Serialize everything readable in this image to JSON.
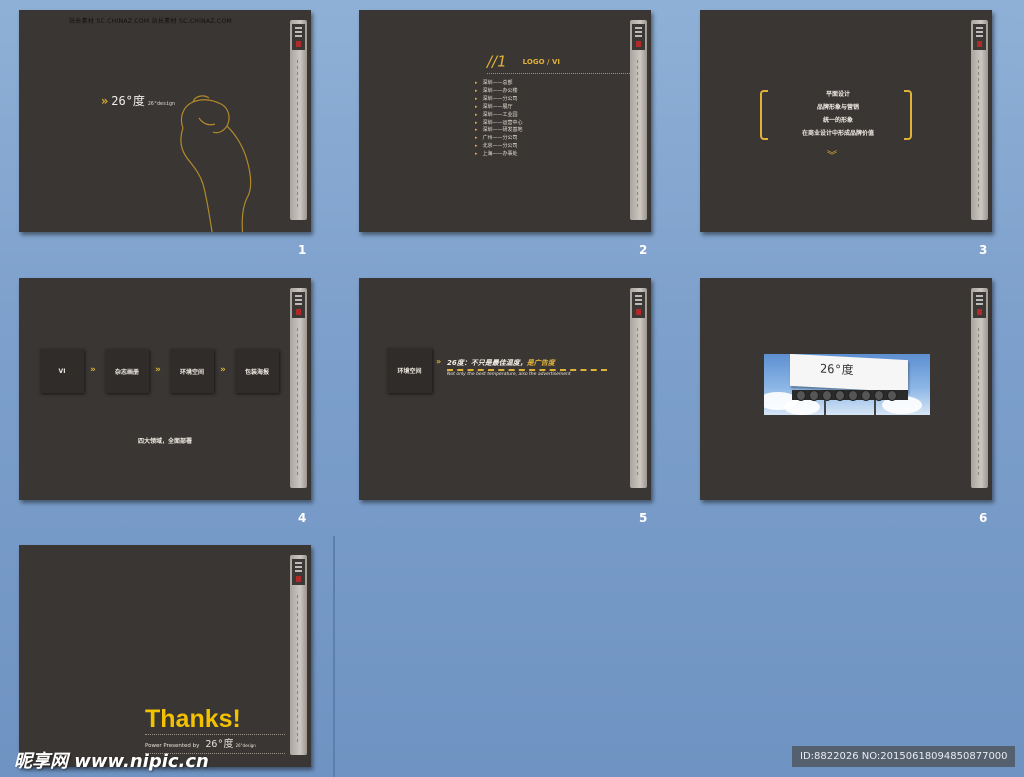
{
  "slides": [
    {
      "number": "1",
      "header": "站长素材 SC.CHINAZ.COM    站长素材 SC.CHINAZ.COM",
      "brand": "26°度",
      "brand_sub": "26°design"
    },
    {
      "number": "2",
      "title": "//1",
      "subtitle": "LOGO / VI",
      "items": [
        "深圳——总部",
        "深圳——办公楼",
        "深圳——分公司",
        "深圳——展厅",
        "深圳——工业园",
        "深圳——运营中心",
        "深圳——研发基地",
        "广州——分公司",
        "北京——分公司",
        "上海——办事处"
      ]
    },
    {
      "number": "3",
      "lines": [
        "平面设计",
        "品牌形象与营销",
        "统一的形象",
        "在商业设计中形成品牌价值"
      ]
    },
    {
      "number": "4",
      "boxes": [
        "VI",
        "杂志画册",
        "环境空间",
        "包装海报"
      ],
      "note": "四大领域，全面部署"
    },
    {
      "number": "5",
      "box": "环境空间",
      "line1_pre": "26度：不只是最佳温度，",
      "line1_hl": "是广告度",
      "line2": "Not only the best temperature, also the advertisement"
    },
    {
      "number": "6",
      "billboard_text": "26°度"
    },
    {
      "number": "7",
      "thanks": "Thanks!",
      "power": "Power Presented  by",
      "brand": "26°度",
      "brand_sub": "26°design"
    }
  ],
  "watermark": "昵享网 www.nipic.cn",
  "id_text": "ID:8822026 NO:20150618094850877000"
}
